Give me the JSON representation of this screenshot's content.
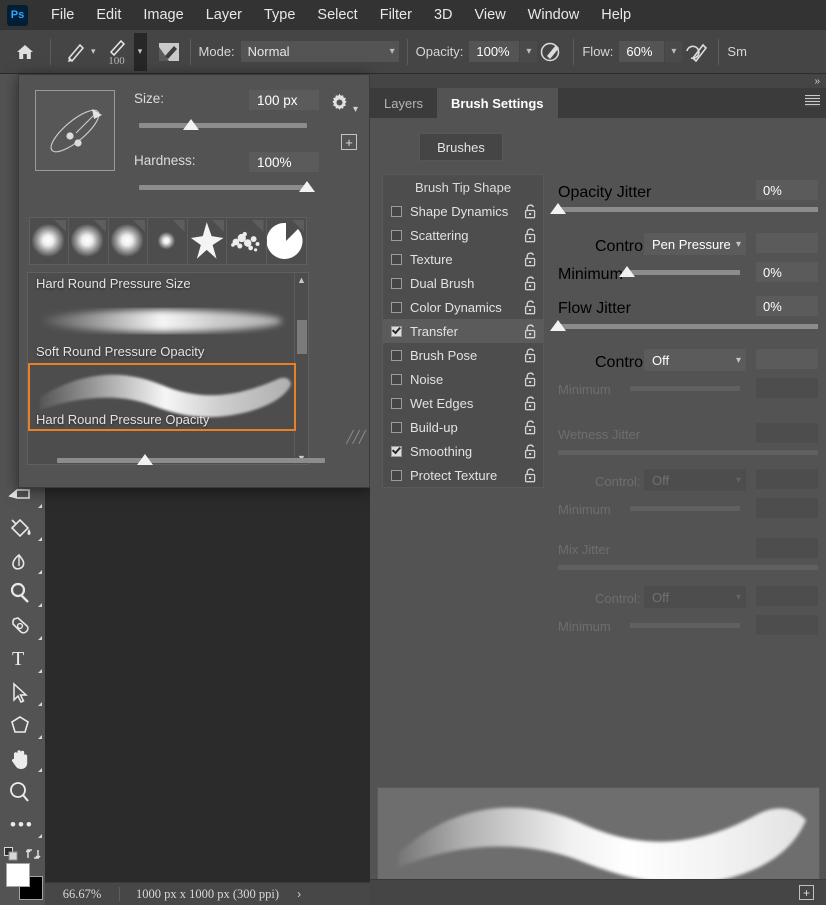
{
  "app": {
    "logo_text": "Ps"
  },
  "menubar": {
    "items": [
      "File",
      "Edit",
      "Image",
      "Layer",
      "Type",
      "Select",
      "Filter",
      "3D",
      "View",
      "Window",
      "Help"
    ]
  },
  "options_bar": {
    "home_icon": "home-icon",
    "brush_preview_icon": "brush-stroke-icon",
    "brush_size_number": "100",
    "brush_panel_icon": "brush-panel-icon",
    "mode_label": "Mode:",
    "mode_value": "Normal",
    "opacity_label": "Opacity:",
    "opacity_value": "100%",
    "airbrush_icon": "airbrush-icon",
    "flow_label": "Flow:",
    "flow_value": "60%",
    "smoothing_icon": "smoothing-icon",
    "smoothing_label": "Sm"
  },
  "toolbar": {
    "expand_icon": "chevron-double-right-icon",
    "tools": [
      {
        "name": "eraser-tool",
        "icon": "eraser-icon"
      },
      {
        "name": "paint-bucket-tool",
        "icon": "paint-bucket-icon"
      },
      {
        "name": "smudge-tool",
        "icon": "smudge-icon"
      },
      {
        "name": "dodge-tool",
        "icon": "dodge-icon"
      },
      {
        "name": "pen-tool",
        "icon": "pen-icon"
      },
      {
        "name": "type-tool",
        "icon": "type-icon"
      },
      {
        "name": "path-selection-tool",
        "icon": "arrow-cursor-icon"
      },
      {
        "name": "shape-tool",
        "icon": "polygon-icon"
      },
      {
        "name": "hand-tool",
        "icon": "hand-icon"
      },
      {
        "name": "zoom-tool",
        "icon": "magnifier-icon"
      },
      {
        "name": "edit-toolbar",
        "icon": "ellipsis-icon"
      }
    ],
    "foreground_color": "#ffffff",
    "background_color": "#000000",
    "reset_icon": "reset-colors-icon",
    "swap_icon": "swap-colors-icon"
  },
  "brush_popup": {
    "preview_icon": "brush-tip-ellipse-icon",
    "size_label": "Size:",
    "size_value": "100 px",
    "size_slider_pct": 31,
    "hardness_label": "Hardness:",
    "hardness_value": "100%",
    "hardness_slider_pct": 100,
    "gear_icon": "gear-icon",
    "add_icon": "plus-icon",
    "thumbnails": [
      {
        "name": "soft-round-pressure-size",
        "type": "soft"
      },
      {
        "name": "soft-round-pressure-opacity",
        "type": "soft"
      },
      {
        "name": "soft-round-pressure-flow",
        "type": "soft"
      },
      {
        "name": "soft-round-small",
        "type": "soft-small"
      },
      {
        "name": "star-brush",
        "type": "star"
      },
      {
        "name": "spatter-brush",
        "type": "spatter"
      },
      {
        "name": "hard-round-pacman",
        "type": "pacman"
      }
    ],
    "presets": [
      {
        "label": "Hard Round Pressure Size",
        "selected": false
      },
      {
        "label": "Soft Round Pressure Opacity",
        "selected": false
      },
      {
        "label": "Hard Round Pressure Opacity",
        "selected": true
      }
    ],
    "scroll_up_icon": "chevron-up-icon",
    "scroll_down_icon": "chevron-down-icon",
    "bottom_slider_pct": 33,
    "resize_grip_icon": "resize-grip-icon"
  },
  "right_panel": {
    "expand_icon": "chevron-double-right-icon",
    "menu_icon": "panel-menu-icon",
    "tabs": [
      {
        "label": "Layers",
        "active": false
      },
      {
        "label": "Brush Settings",
        "active": true
      }
    ],
    "brushes_button": "Brushes",
    "sections_header": "Brush Tip Shape",
    "sections": [
      {
        "label": "Shape Dynamics",
        "checked": false,
        "selected": false,
        "lock_icon": "unlock-icon"
      },
      {
        "label": "Scattering",
        "checked": false,
        "selected": false,
        "lock_icon": "unlock-icon"
      },
      {
        "label": "Texture",
        "checked": false,
        "selected": false,
        "lock_icon": "unlock-icon"
      },
      {
        "label": "Dual Brush",
        "checked": false,
        "selected": false,
        "lock_icon": "unlock-icon"
      },
      {
        "label": "Color Dynamics",
        "checked": false,
        "selected": false,
        "lock_icon": "unlock-icon"
      },
      {
        "label": "Transfer",
        "checked": true,
        "selected": true,
        "lock_icon": "unlock-icon"
      },
      {
        "label": "Brush Pose",
        "checked": false,
        "selected": false,
        "lock_icon": "unlock-icon"
      },
      {
        "label": "Noise",
        "checked": false,
        "selected": false,
        "lock_icon": "unlock-icon"
      },
      {
        "label": "Wet Edges",
        "checked": false,
        "selected": false,
        "lock_icon": "unlock-icon"
      },
      {
        "label": "Build-up",
        "checked": false,
        "selected": false,
        "lock_icon": "unlock-icon"
      },
      {
        "label": "Smoothing",
        "checked": true,
        "selected": false,
        "lock_icon": "unlock-icon"
      },
      {
        "label": "Protect Texture",
        "checked": false,
        "selected": false,
        "lock_icon": "unlock-icon"
      }
    ],
    "transfer": {
      "opacity_jitter_label": "Opacity Jitter",
      "opacity_jitter_value": "0%",
      "opacity_jitter_pct": 0,
      "opacity_control_label": "Control:",
      "opacity_control_value": "Pen Pressure",
      "opacity_minimum_label": "Minimum",
      "opacity_minimum_value": "0%",
      "opacity_minimum_pct": 0,
      "flow_jitter_label": "Flow Jitter",
      "flow_jitter_value": "0%",
      "flow_jitter_pct": 0,
      "flow_control_label": "Control:",
      "flow_control_value": "Off",
      "flow_minimum_label": "Minimum",
      "wetness_jitter_label": "Wetness Jitter",
      "wetness_control_label": "Control:",
      "wetness_control_value": "Off",
      "wetness_minimum_label": "Minimum",
      "mix_jitter_label": "Mix Jitter",
      "mix_control_label": "Control:",
      "mix_control_value": "Off",
      "mix_minimum_label": "Minimum"
    },
    "stroke_preview_name": "brush-stroke-preview",
    "footer_add_icon": "plus-icon"
  },
  "status_bar": {
    "zoom": "66.67%",
    "dimensions": "1000 px x 1000 px (300 ppi)",
    "arrow_icon": "chevron-right-icon"
  },
  "colors": {
    "accent_orange": "#e8802a",
    "panel_bg": "#535353",
    "toolbar_bg": "#454545",
    "menubar_bg": "#333333",
    "canvas_bg": "#2b2b2b"
  }
}
